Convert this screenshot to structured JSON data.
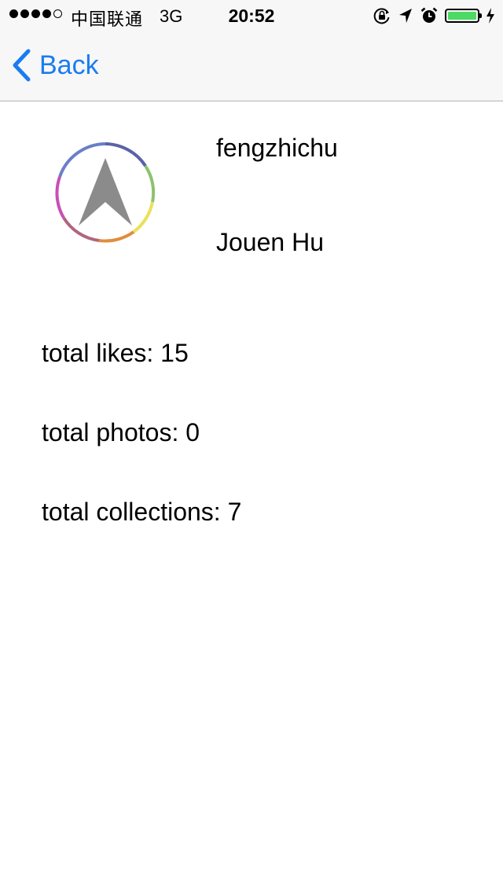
{
  "status_bar": {
    "carrier": "中国联通",
    "network": "3G",
    "time": "20:52",
    "battery_level": 1.0,
    "battery_color": "#4cd964"
  },
  "nav": {
    "back_label": "Back",
    "accent_color": "#1a7cf1"
  },
  "profile": {
    "avatar_icon": "navigation-arrow-logo",
    "username": "fengzhichu",
    "full_name": "Jouen Hu"
  },
  "stats": {
    "likes": "total likes: 15",
    "photos": "total photos: 0",
    "collections": "total collections: 7"
  }
}
